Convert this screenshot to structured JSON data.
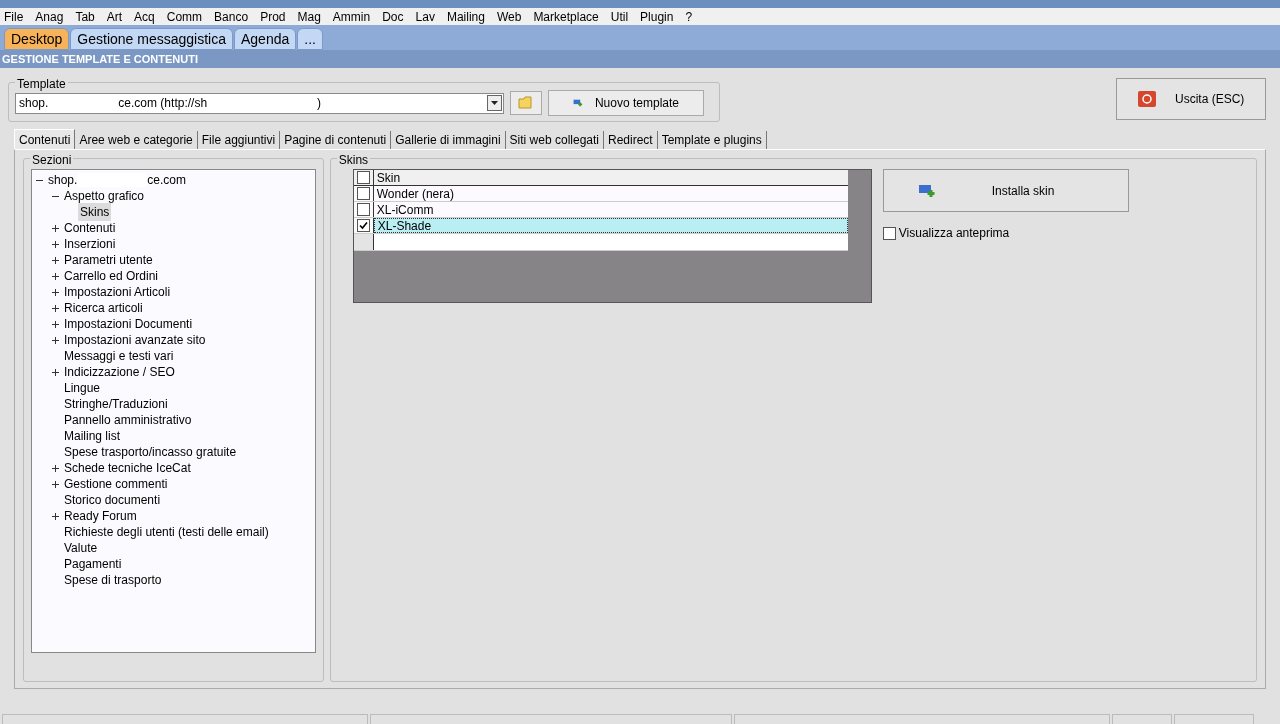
{
  "menu": [
    "File",
    "Anag",
    "Tab",
    "Art",
    "Acq",
    "Comm",
    "Banco",
    "Prod",
    "Mag",
    "Ammin",
    "Doc",
    "Lav",
    "Mailing",
    "Web",
    "Marketplace",
    "Util",
    "Plugin",
    "?"
  ],
  "desktop_tabs": [
    {
      "label": "Desktop",
      "selected": true
    },
    {
      "label": "Gestione messaggistica",
      "selected": false
    },
    {
      "label": "Agenda",
      "selected": false
    },
    {
      "label": "...",
      "selected": false
    }
  ],
  "section_title": "GESTIONE TEMPLATE E CONTENUTI",
  "template": {
    "label": "Template",
    "value_parts": [
      "shop.",
      "ce.com (http://sh",
      ")"
    ],
    "new_button": "Nuovo template"
  },
  "exit_button": "Uscita (ESC)",
  "tabs": [
    {
      "label": "Contenuti",
      "selected": true
    },
    {
      "label": "Aree web e categorie",
      "selected": false
    },
    {
      "label": "File aggiuntivi",
      "selected": false
    },
    {
      "label": "Pagine di contenuti",
      "selected": false
    },
    {
      "label": "Gallerie di immagini",
      "selected": false
    },
    {
      "label": "Siti web collegati",
      "selected": false
    },
    {
      "label": "Redirect",
      "selected": false
    },
    {
      "label": "Template e plugins",
      "selected": false
    }
  ],
  "sections": {
    "label": "Sezioni",
    "tree": [
      {
        "label_parts": [
          "shop.",
          "ce.com"
        ],
        "expanded": true,
        "selected": false,
        "children": [
          {
            "label": "Aspetto grafico",
            "expanded": true,
            "selected": false,
            "children": [
              {
                "label": "Skins",
                "selected": true
              }
            ]
          },
          {
            "label": "Contenuti",
            "expanded": false,
            "selected": false
          },
          {
            "label": "Inserzioni",
            "expanded": false,
            "selected": false
          },
          {
            "label": "Parametri utente",
            "expanded": false,
            "selected": false
          },
          {
            "label": "Carrello ed Ordini",
            "expanded": false,
            "selected": false
          },
          {
            "label": "Impostazioni Articoli",
            "expanded": false,
            "selected": false
          },
          {
            "label": "Ricerca articoli",
            "expanded": false,
            "selected": false
          },
          {
            "label": "Impostazioni Documenti",
            "expanded": false,
            "selected": false
          },
          {
            "label": "Impostazioni avanzate sito",
            "expanded": false,
            "selected": false
          },
          {
            "label": "Messaggi e testi vari",
            "selected": false
          },
          {
            "label": "Indicizzazione / SEO",
            "expanded": false,
            "selected": false
          },
          {
            "label": "Lingue",
            "selected": false
          },
          {
            "label": "Stringhe/Traduzioni",
            "selected": false
          },
          {
            "label": "Pannello amministrativo",
            "selected": false
          },
          {
            "label": "Mailing list",
            "selected": false
          },
          {
            "label": "Spese trasporto/incasso gratuite",
            "selected": false
          },
          {
            "label": "Schede tecniche IceCat",
            "expanded": false,
            "selected": false
          },
          {
            "label": "Gestione commenti",
            "expanded": false,
            "selected": false
          },
          {
            "label": "Storico documenti",
            "selected": false
          },
          {
            "label": "Ready Forum",
            "expanded": false,
            "selected": false
          },
          {
            "label": "Richieste degli utenti (testi delle email)",
            "selected": false
          },
          {
            "label": "Valute",
            "selected": false
          },
          {
            "label": "Pagamenti",
            "selected": false
          },
          {
            "label": "Spese di trasporto",
            "selected": false
          }
        ]
      }
    ]
  },
  "skins": {
    "label": "Skins",
    "column": "Skin",
    "header_checked": false,
    "rows": [
      {
        "name": "Wonder (nera)",
        "checked": false,
        "selected": false
      },
      {
        "name": "XL-iComm",
        "checked": false,
        "selected": false
      },
      {
        "name": "XL-Shade",
        "checked": true,
        "selected": true
      }
    ],
    "install_button": "Installa skin",
    "preview": {
      "label": "Visualizza anteprima",
      "checked": false
    }
  }
}
